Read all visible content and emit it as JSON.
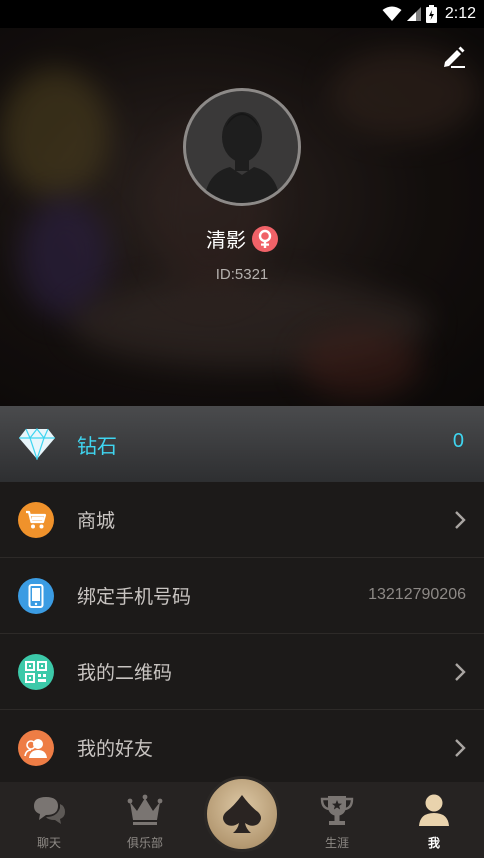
{
  "status_bar": {
    "time": "2:12"
  },
  "profile": {
    "name": "清影",
    "id_text": "ID:5321"
  },
  "diamond": {
    "label": "钻石",
    "value": "0"
  },
  "menu": {
    "items": [
      {
        "label": "商城",
        "icon": "cart-icon",
        "color": "#f0922b"
      },
      {
        "label": "绑定手机号码",
        "icon": "phone-icon",
        "color": "#3b9ce3",
        "value": "13212790206"
      },
      {
        "label": "我的二维码",
        "icon": "qr-code-icon",
        "color": "#3cc9a9"
      },
      {
        "label": "我的好友",
        "icon": "friends-icon",
        "color": "#ee7d45"
      }
    ]
  },
  "tabs": [
    {
      "label": "聊天",
      "icon": "chat-icon"
    },
    {
      "label": "俱乐部",
      "icon": "crown-icon"
    },
    {
      "label": "生涯",
      "icon": "trophy-icon"
    },
    {
      "label": "我",
      "icon": "person-icon",
      "active": true
    }
  ],
  "colors": {
    "accent_cyan": "#3fd5f0",
    "gender_female": "#f06268",
    "center_gold": "#c8ae87"
  }
}
